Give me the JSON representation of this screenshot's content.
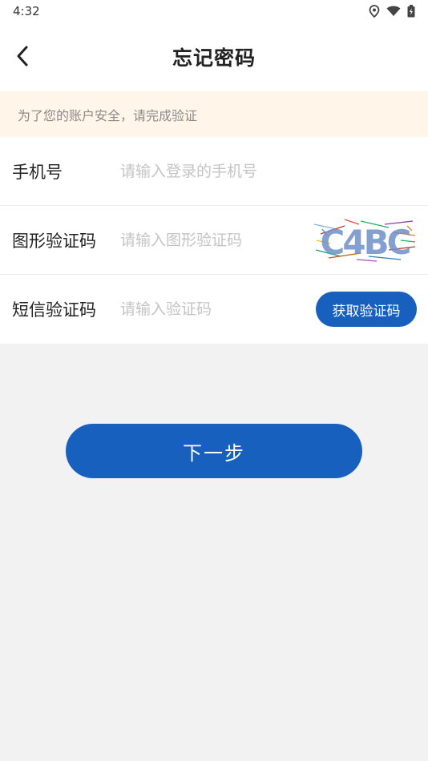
{
  "status_bar": {
    "time": "4:32",
    "icons": [
      "location-icon",
      "wifi-icon",
      "battery-icon"
    ]
  },
  "header": {
    "back_icon": "chevron-left-icon",
    "title": "忘记密码"
  },
  "notice": {
    "text": "为了您的账户安全，请完成验证"
  },
  "form": {
    "phone": {
      "label": "手机号",
      "value": "",
      "placeholder": "请输入登录的手机号"
    },
    "captcha": {
      "label": "图形验证码",
      "value": "",
      "placeholder": "请输入图形验证码",
      "image_text": "C4BC"
    },
    "sms": {
      "label": "短信验证码",
      "value": "",
      "placeholder": "请输入验证码",
      "button_label": "获取验证码"
    }
  },
  "next_button": {
    "label": "下一步"
  },
  "colors": {
    "primary": "#1760bd",
    "notice_bg": "#fff6e9",
    "page_bg": "#f2f2f2"
  }
}
